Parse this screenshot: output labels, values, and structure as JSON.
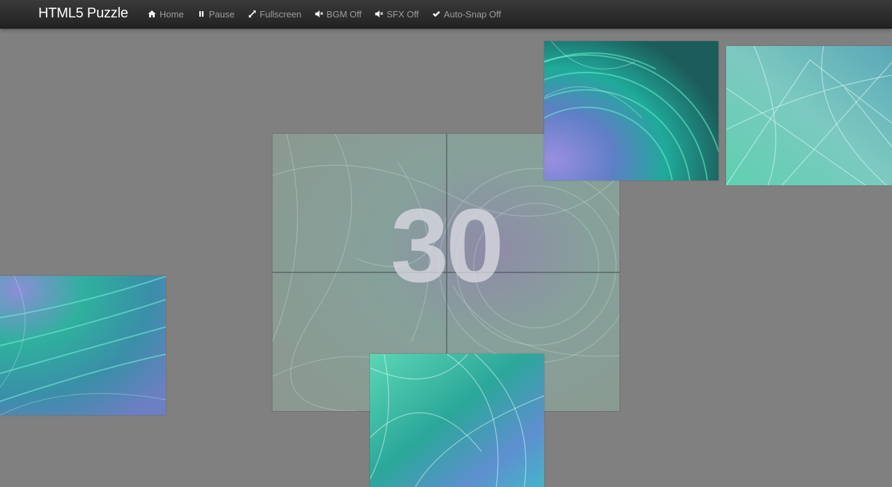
{
  "app": {
    "title": "HTML5 Puzzle"
  },
  "nav": {
    "items": [
      {
        "name": "nav-home",
        "icon": "home-icon",
        "label": "Home"
      },
      {
        "name": "nav-pause",
        "icon": "pause-icon",
        "label": "Pause"
      },
      {
        "name": "nav-fullscreen",
        "icon": "fullscreen-icon",
        "label": "Fullscreen"
      },
      {
        "name": "nav-bgm",
        "icon": "volume-off-icon",
        "label": "BGM Off"
      },
      {
        "name": "nav-sfx",
        "icon": "volume-off-icon",
        "label": "SFX Off"
      },
      {
        "name": "nav-autosnap",
        "icon": "check-icon",
        "label": "Auto-Snap Off"
      }
    ]
  },
  "game": {
    "countdown": "30",
    "grid": {
      "rows": 2,
      "cols": 2
    },
    "pieces": [
      {
        "id": "piece-top-right-area",
        "image": "fractal-swirl-teal-purple"
      },
      {
        "id": "piece-far-right",
        "image": "fractal-veils-light-teal"
      },
      {
        "id": "piece-left",
        "image": "fractal-swirl-blue-teal"
      },
      {
        "id": "piece-bottom",
        "image": "fractal-veils-green-blue"
      }
    ]
  },
  "colors": {
    "background": "#808080",
    "navbar": "#2b2b2b",
    "nav_text": "#9d9d9d",
    "brand_text": "#ffffff",
    "teal": "#1fa99a",
    "purple": "#7b7fc4",
    "light_teal": "#7fd9c4"
  }
}
